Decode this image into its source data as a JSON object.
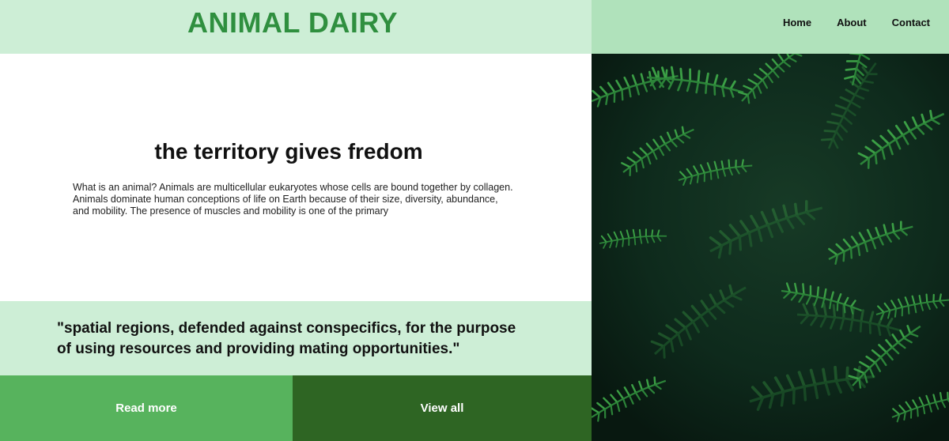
{
  "brand": "ANIMAL DAIRY",
  "nav": {
    "home": "Home",
    "about": "About",
    "contact": "Contact"
  },
  "hero": {
    "heading": "the territory gives fredom",
    "body": "What is an animal? Animals are multicellular eukaryotes whose cells are bound together by collagen. Animals dominate human conceptions of life on Earth because of their size, diversity, abundance, and mobility. The presence of muscles and mobility is one of the primary"
  },
  "quote": "\"spatial regions, defended against conspecifics, for the purpose of using resources and providing mating opportunities.\"",
  "buttons": {
    "read_more": "Read more",
    "view_all": "View all"
  },
  "colors": {
    "header_light": "#cdeed6",
    "header_right": "#b0e2bb",
    "brand_green": "#2f8f3f",
    "button_light": "#57b35d",
    "button_dark": "#2e6523",
    "photo_bg": "#0c2118"
  },
  "image": {
    "subject": "evergreen-foliage-photo"
  }
}
